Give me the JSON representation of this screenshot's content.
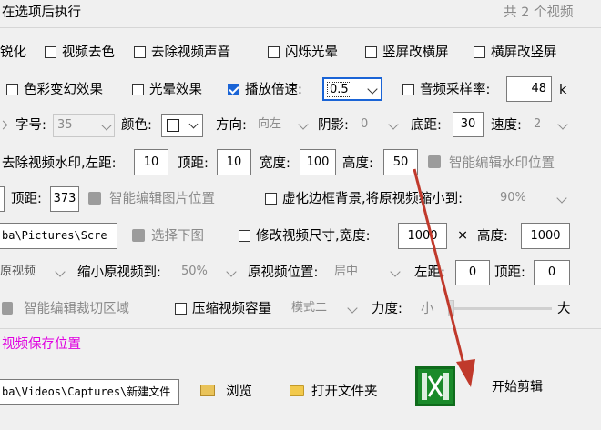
{
  "header": {
    "title": "在选项后执行",
    "count": "共 2 个视频"
  },
  "row1": {
    "sharpen": "锐化",
    "desaturate": "视频去色",
    "mute": "去除视频声音",
    "flash": "闪烁光晕",
    "vertical": "竖屏改横屏",
    "horizontal": "横屏改竖屏"
  },
  "row2": {
    "color_warp": "色彩变幻效果",
    "light": "光晕效果",
    "speed_label": "播放倍速:",
    "speed_value": "0.5",
    "samplerate_label": "音频采样率:",
    "samplerate_value": "48",
    "samplerate_unit": "k"
  },
  "row3": {
    "size_label": "字号:",
    "size_value": "35",
    "color_label": "颜色:",
    "dir_label": "方向:",
    "dir_value": "向左",
    "shadow_label": "阴影:",
    "shadow_value": "0",
    "bottom_label": "底距:",
    "bottom_value": "30",
    "speed_label": "速度:",
    "speed_value": "2"
  },
  "row4": {
    "watermark_label": "去除视频水印,左距:",
    "left_value": "10",
    "top_label": "顶距:",
    "top_value": "10",
    "width_label": "宽度:",
    "width_value": "100",
    "height_label": "高度:",
    "height_value": "50",
    "smart_btn": "智能编辑水印位置"
  },
  "row5": {
    "top_label": "顶距:",
    "top_value": "373",
    "smart_btn": "智能编辑图片位置",
    "blur_label": "虚化边框背景,将原视频缩小到:",
    "blur_value": "90%"
  },
  "row6": {
    "path_value": "ba\\Pictures\\Scre",
    "select_btn": "选择下图",
    "resize_label": "修改视频尺寸,宽度:",
    "width_value": "1000",
    "times": "×",
    "height_label": "高度:",
    "height_value": "1000"
  },
  "row7": {
    "source_value": "原视频",
    "shrink_label": "缩小原视频到:",
    "shrink_value": "50%",
    "pos_label": "原视频位置:",
    "pos_value": "居中",
    "left_label": "左距:",
    "left_value": "0",
    "top_label": "顶距:",
    "top_value": "0"
  },
  "row8": {
    "crop_btn": "智能编辑裁切区域",
    "compress_label": "压缩视频容量",
    "mode_value": "模式二",
    "force_label": "力度:",
    "small": "小",
    "large": "大"
  },
  "save": {
    "title": "视频保存位置",
    "path_value": "ba\\Videos\\Captures\\新建文件",
    "browse_btn": "浏览",
    "open_btn": "打开文件夹",
    "start_btn": "开始剪辑"
  },
  "colors": {
    "accent": "#1a64d6",
    "save_title": "#e000e0",
    "arrow": "#c0392b",
    "start_icon": "#1a8a2a"
  }
}
